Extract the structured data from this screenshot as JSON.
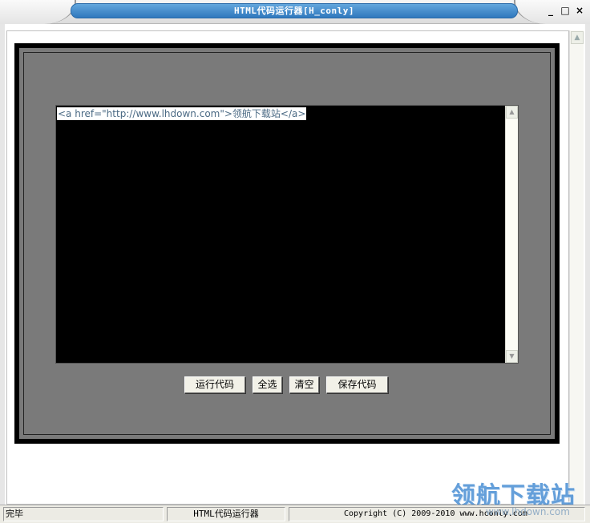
{
  "window": {
    "title": "HTML代码运行器[H_conly]",
    "minimize_glyph": "_",
    "maximize_glyph": "□",
    "close_glyph": "×"
  },
  "editor": {
    "code": "<a href=\"http://www.lhdown.com\">领航下载站</a>"
  },
  "buttons": {
    "run": "运行代码",
    "select_all": "全选",
    "clear": "清空",
    "save": "保存代码"
  },
  "status": {
    "state": "完毕",
    "app_name": "HTML代码运行器",
    "copyright": "Copyright (C) 2009-2010 www.hconly.com"
  },
  "watermark": {
    "logo_text": "领航下载站",
    "url": "www.lhdown.com"
  },
  "colors": {
    "title_pill": "#3a86cc",
    "panel_gray": "#7a7a7a",
    "editor_bg": "#000000",
    "code_text": "#4b6a84"
  },
  "icons": {
    "scroll_up": "▲",
    "scroll_down": "▼"
  }
}
